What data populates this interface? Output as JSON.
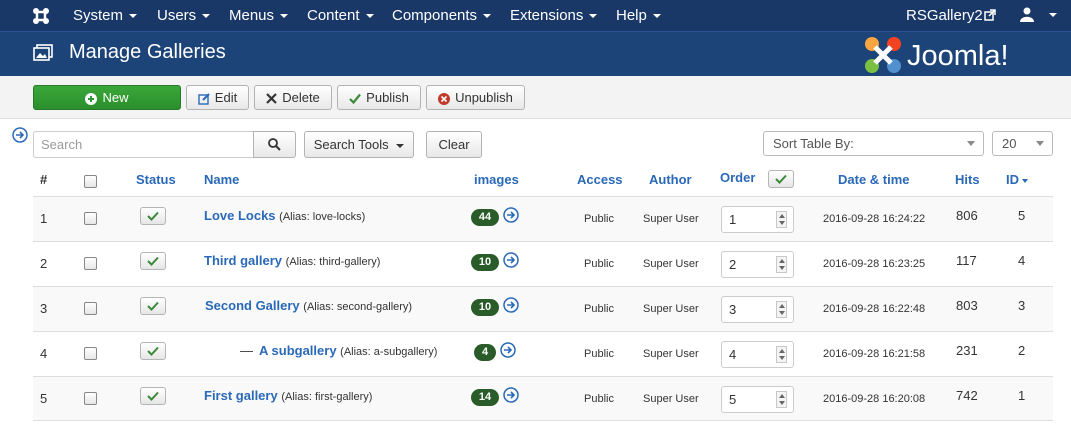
{
  "navbar": {
    "menus": [
      "System",
      "Users",
      "Menus",
      "Content",
      "Components",
      "Extensions",
      "Help"
    ],
    "site_link": "RSGallery2"
  },
  "header": {
    "title": "Manage Galleries",
    "brand": "Joomla!"
  },
  "toolbar": {
    "new": "New",
    "edit": "Edit",
    "delete": "Delete",
    "publish": "Publish",
    "unpublish": "Unpublish"
  },
  "filters": {
    "search_placeholder": "Search",
    "search_tools": "Search Tools",
    "clear": "Clear",
    "sort_by": "Sort Table By:",
    "limit": "20"
  },
  "table": {
    "headers": {
      "num": "#",
      "status": "Status",
      "name": "Name",
      "images": "images",
      "access": "Access",
      "author": "Author",
      "order": "Order",
      "date": "Date & time",
      "hits": "Hits",
      "id": "ID"
    },
    "rows": [
      {
        "num": "1",
        "name": "Love Locks",
        "alias": "(Alias: love-locks)",
        "images": "44",
        "access": "Public",
        "author": "Super User",
        "order": "1",
        "date": "2016-09-28 16:24:22",
        "hits": "806",
        "id": "5"
      },
      {
        "num": "2",
        "name": "Third gallery",
        "alias": "(Alias: third-gallery)",
        "images": "10",
        "access": "Public",
        "author": "Super User",
        "order": "2",
        "date": "2016-09-28 16:23:25",
        "hits": "117",
        "id": "4"
      },
      {
        "num": "3",
        "name": "Second Gallery",
        "alias": "(Alias: second-gallery)",
        "images": "10",
        "access": "Public",
        "author": "Super User",
        "order": "3",
        "date": "2016-09-28 16:22:48",
        "hits": "803",
        "id": "3"
      },
      {
        "num": "4",
        "prefix": "—",
        "name": "A subgallery",
        "alias": "(Alias: a-subgallery)",
        "images": "4",
        "access": "Public",
        "author": "Super User",
        "order": "4",
        "date": "2016-09-28 16:21:58",
        "hits": "231",
        "id": "2"
      },
      {
        "num": "5",
        "name": "First gallery",
        "alias": "(Alias: first-gallery)",
        "images": "14",
        "access": "Public",
        "author": "Super User",
        "order": "5",
        "date": "2016-09-28 16:20:08",
        "hits": "742",
        "id": "1"
      }
    ]
  },
  "colors": {
    "navbar": "#1a3867",
    "header": "#1d4479",
    "new_button": "#2f9a2f",
    "link": "#2a69b8",
    "badge": "#2a5c2a"
  },
  "icons": [
    "joomla-icon",
    "external-link-icon",
    "user-icon",
    "images-icon",
    "plus-circle-icon",
    "edit-icon",
    "close-icon",
    "check-icon",
    "times-circle-icon",
    "sidebar-toggle-icon",
    "search-icon",
    "arrow-circle-right-icon"
  ]
}
